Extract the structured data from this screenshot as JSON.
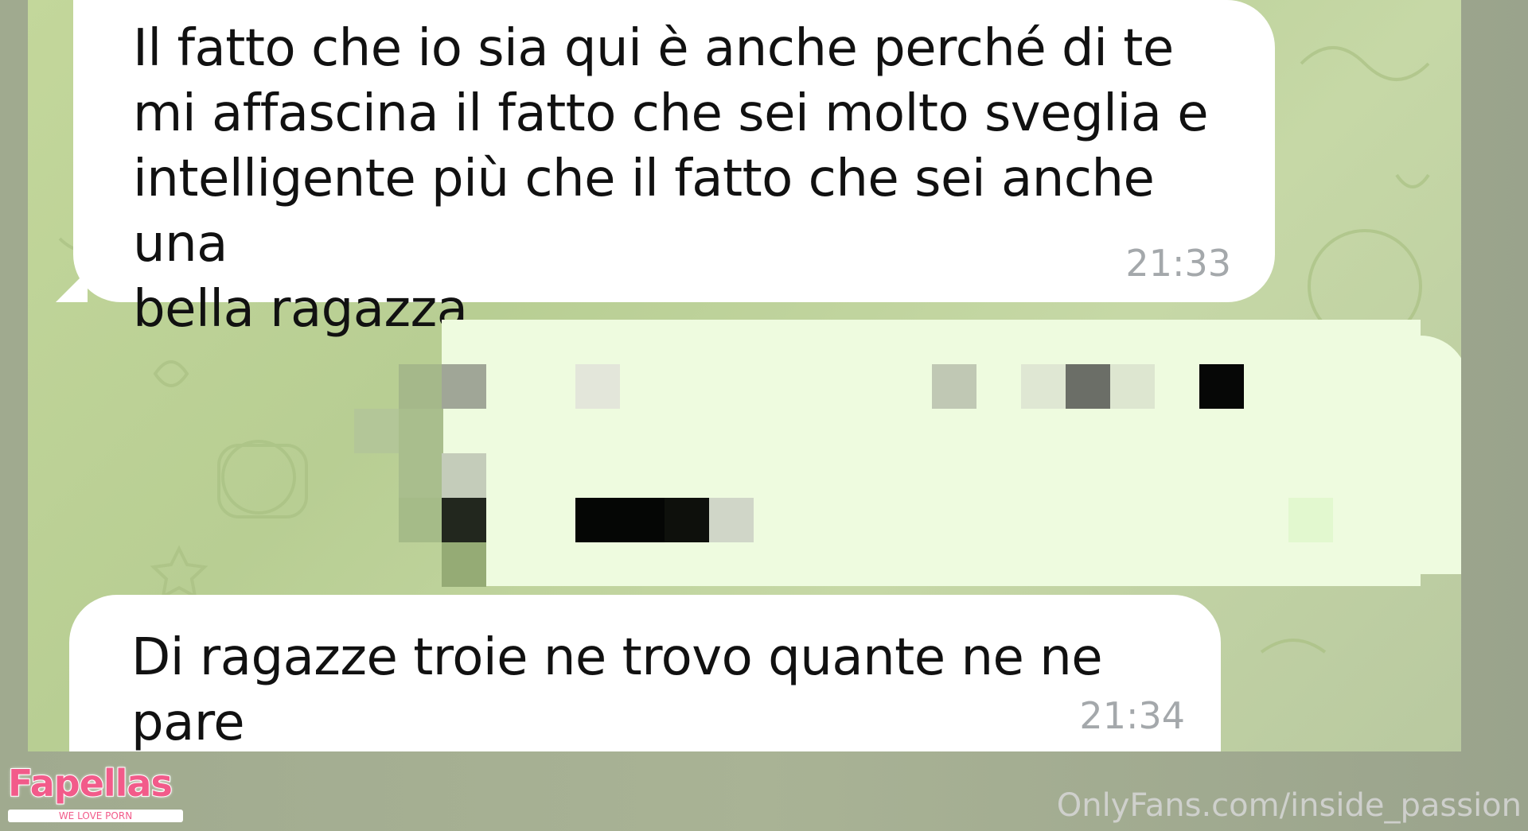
{
  "chat": {
    "messages": [
      {
        "text": "Il fatto che io sia qui è anche perché di te\nmi affascina il fatto che sei molto sveglia e\nintelligente più che il fatto che sei anche una\nbella ragazza",
        "time": "21:33",
        "direction": "incoming"
      },
      {
        "text": "",
        "time": "",
        "direction": "outgoing",
        "redacted": true
      },
      {
        "text": "Di ragazze troie ne trovo quante ne ne pare",
        "time": "21:34",
        "direction": "incoming"
      }
    ]
  },
  "footer": {
    "logo": "Fapellas",
    "logo_tagline": "WE LOVE PORN",
    "watermark": "OnlyFans.com/inside_passion"
  },
  "colors": {
    "chat_background": "#bfd49b",
    "incoming_bubble": "#ffffff",
    "outgoing_bubble": "#eefbdf",
    "time_text": "#a4a8ab",
    "logo_pink": "#f25b8a"
  }
}
